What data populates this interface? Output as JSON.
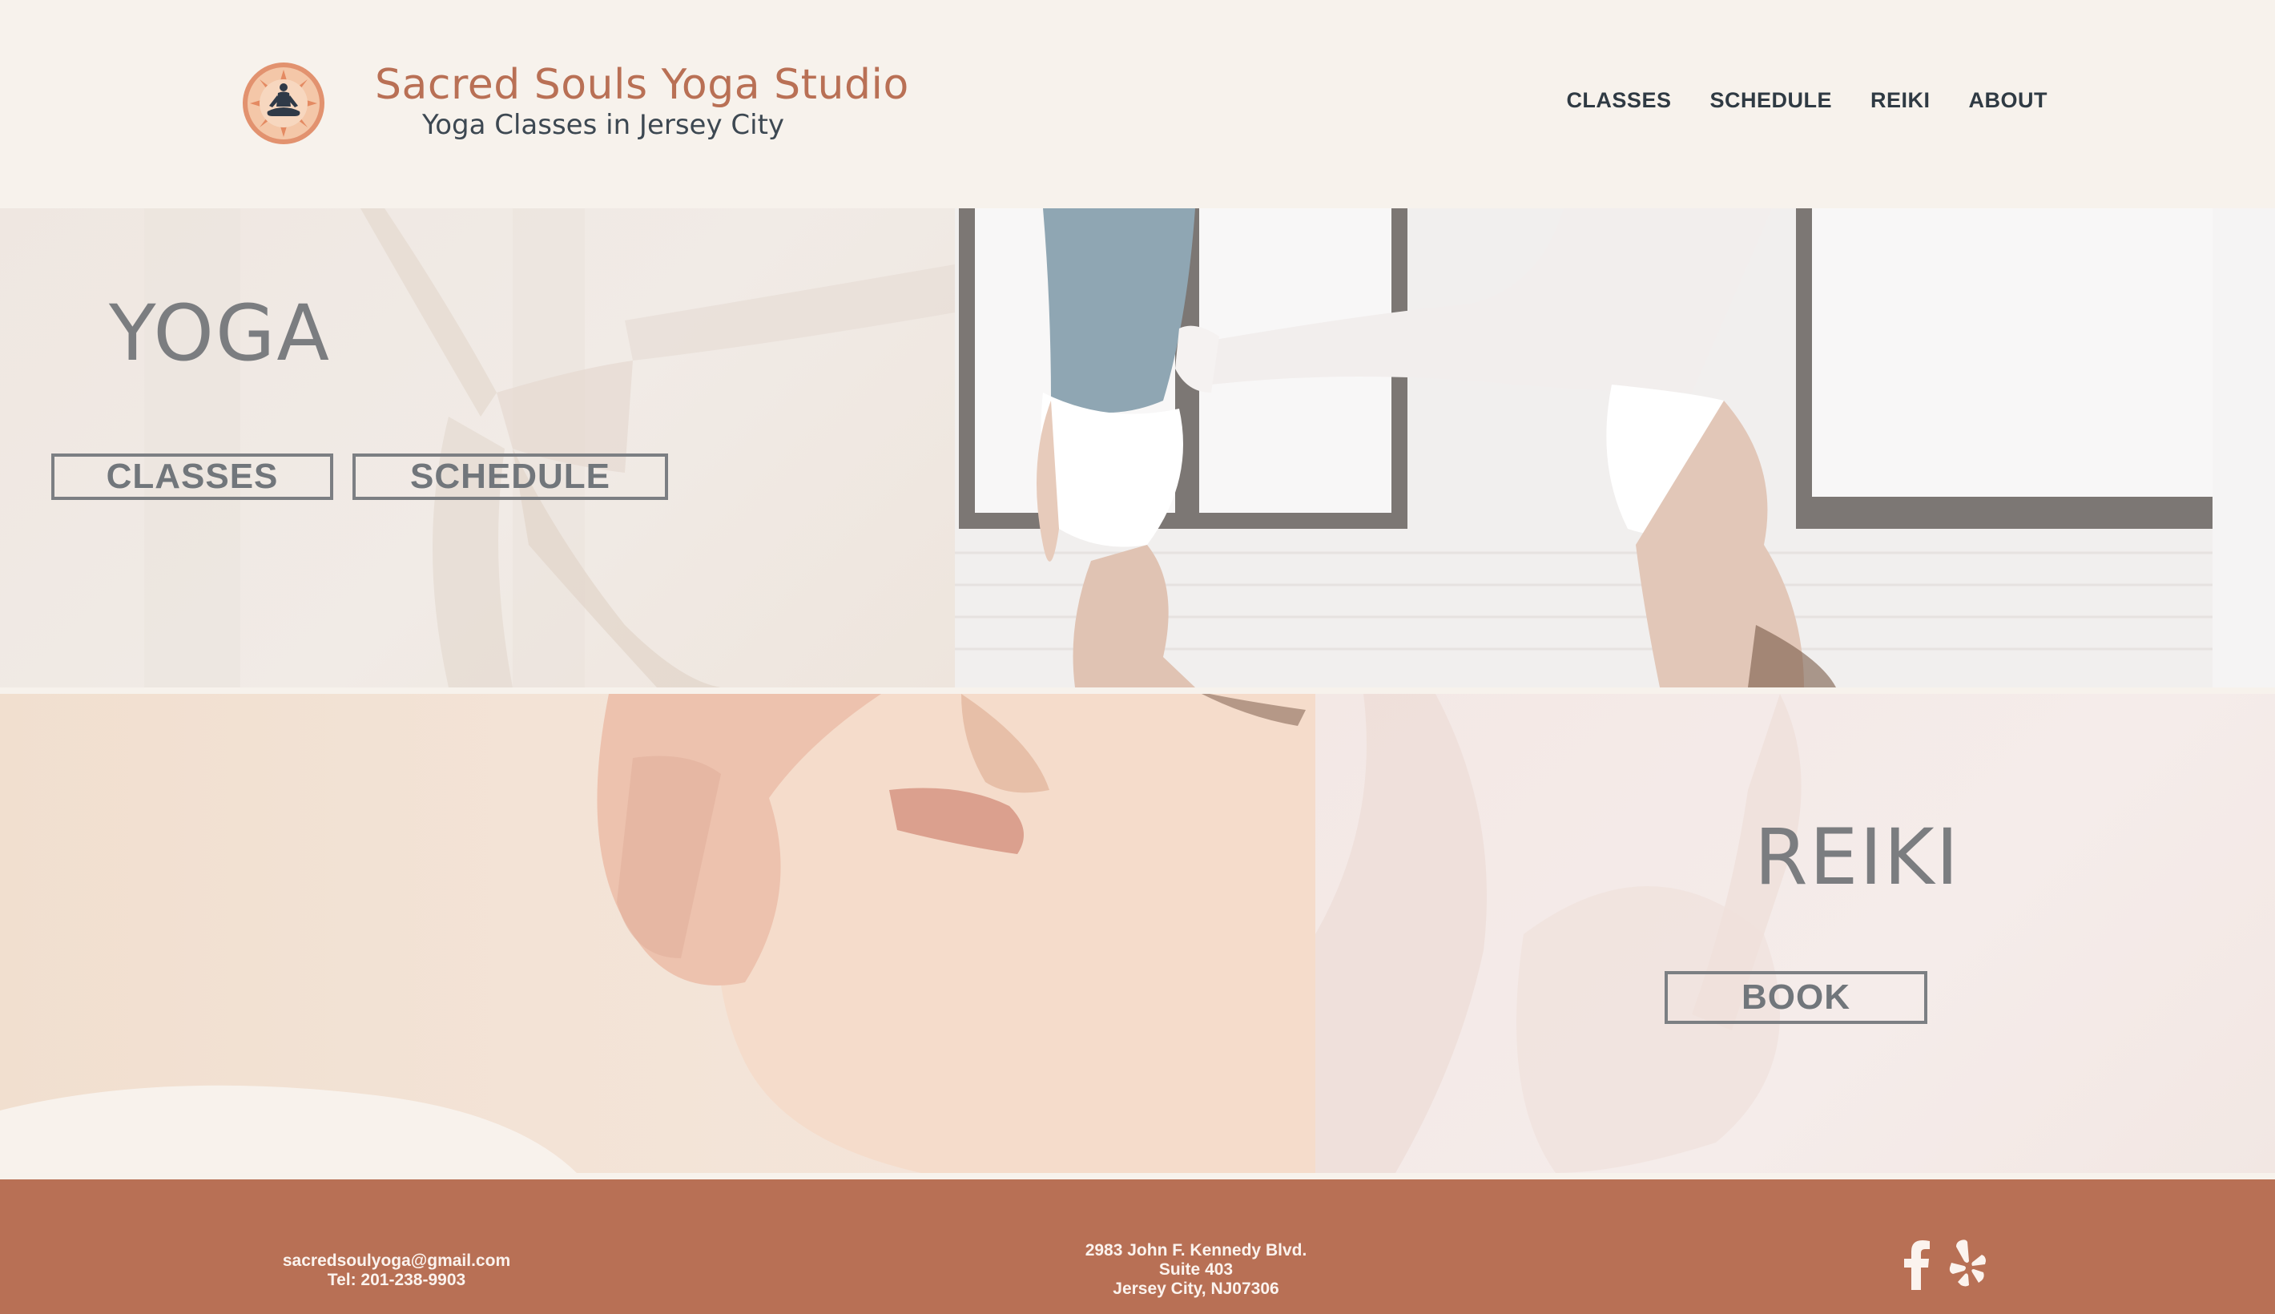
{
  "header": {
    "logo_icon": "meditation-mandala-icon",
    "title": "Sacred Souls Yoga Studio",
    "subtitle": "Yoga Classes in Jersey City",
    "nav": [
      {
        "label": "CLASSES"
      },
      {
        "label": "SCHEDULE"
      },
      {
        "label": "REIKI"
      },
      {
        "label": "ABOUT"
      }
    ]
  },
  "yoga": {
    "heading": "YOGA",
    "classes_button": "CLASSES",
    "schedule_button": "SCHEDULE"
  },
  "reiki": {
    "heading": "REIKI",
    "book_button": "BOOK"
  },
  "footer": {
    "email": "sacredsoulyoga@gmail.com",
    "phone": "Tel: 201-238-9903",
    "address_line1": "2983 John F. Kennedy Blvd.",
    "address_line2": "Suite 403",
    "address_line3": "Jersey City, NJ07306",
    "social": [
      "facebook-icon",
      "yelp-icon"
    ]
  },
  "colors": {
    "brand": "#b87055",
    "background": "#f7f2ec",
    "nav_text": "#2f3a43",
    "button_outline": "#7c7f83"
  }
}
